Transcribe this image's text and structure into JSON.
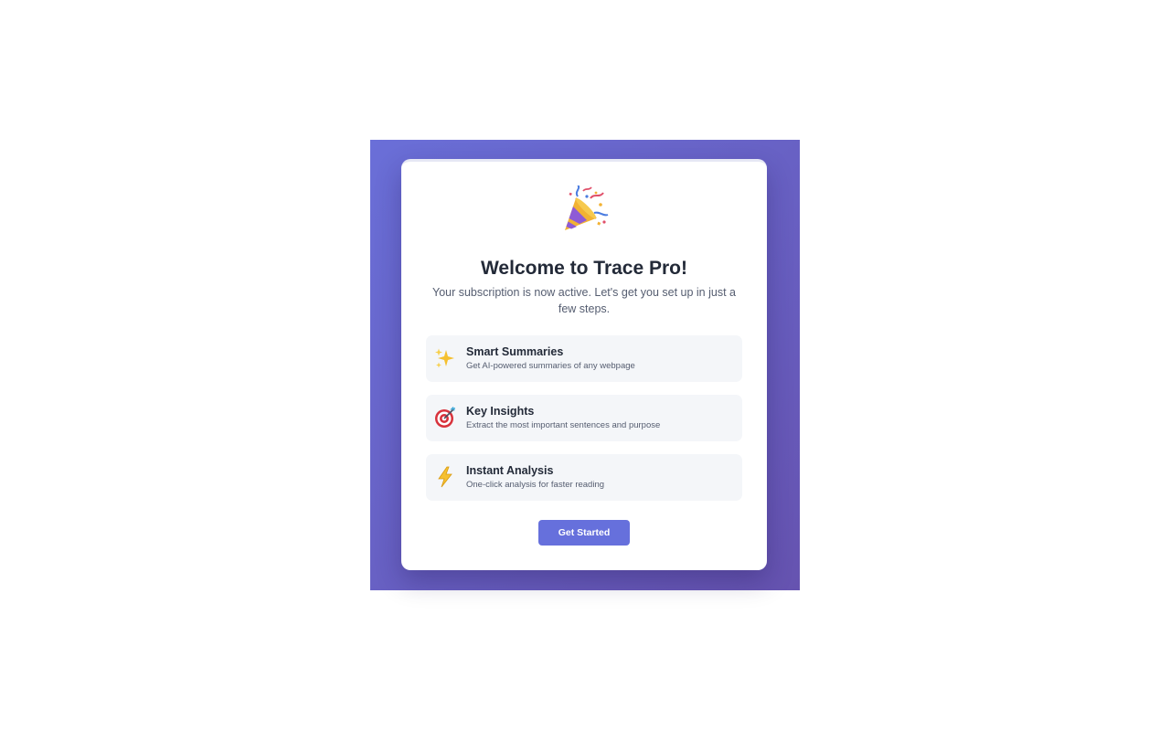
{
  "welcome": {
    "hero_icon": "party-popper-icon",
    "title": "Welcome to Trace Pro!",
    "subtitle": "Your subscription is now active. Let's get you set up in just a few steps."
  },
  "features": [
    {
      "icon": "sparkles-icon",
      "title": "Smart Summaries",
      "description": "Get AI-powered summaries of any webpage"
    },
    {
      "icon": "target-icon",
      "title": "Key Insights",
      "description": "Extract the most important sentences and purpose"
    },
    {
      "icon": "lightning-icon",
      "title": "Instant Analysis",
      "description": "One-click analysis for faster reading"
    }
  ],
  "cta": {
    "label": "Get Started"
  },
  "colors": {
    "gradient_start": "#6a6fd8",
    "gradient_end": "#6653b0",
    "button": "#6670dc",
    "feature_bg": "#f4f6f9",
    "title_text": "#232a38",
    "body_text": "#555d70"
  }
}
